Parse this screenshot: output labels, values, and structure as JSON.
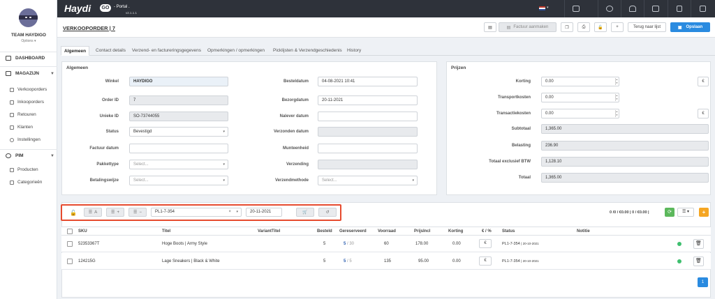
{
  "sidebar": {
    "team": "TEAM HAYDIGO",
    "options": "Options ▾",
    "sections": [
      {
        "label": "DASHBOARD"
      },
      {
        "label": "MAGAZIJN"
      },
      {
        "label": "PIM"
      }
    ],
    "magazijn_items": [
      "Verkooporders",
      "Inkooporders",
      "Retouren",
      "Klanten",
      "Instellingen"
    ],
    "pim_items": [
      "Producten",
      "Categorieën"
    ]
  },
  "topbar": {
    "logo": "Haydi",
    "logo_go": "GO",
    "portal": "- Portal .",
    "version": "v2.1.1.1"
  },
  "header": {
    "title": "VERKOOPORDER | 7",
    "invoice_button": "Factuur aanmaken",
    "back_button": "Terug naar lijst",
    "save_button": "Opslaan"
  },
  "tabs": [
    "Algemeen",
    "Contact details",
    "Verzend- en factureringsgegevens",
    "Opmerkingen / opmerkingen",
    "Picklijsten & Verzendgeschiedenis",
    "History"
  ],
  "general": {
    "heading": "Algemeen",
    "winkel_label": "Winkel",
    "winkel": "HAYDIGO",
    "order_id_label": "Order ID",
    "order_id": "7",
    "unieke_id_label": "Unieke ID",
    "unieke_id": "SO-73744055",
    "status_label": "Status",
    "status": "Bevestigd",
    "factuur_datum_label": "Factuur datum",
    "factuur_datum": "",
    "pakkettype_label": "Pakkettype",
    "pakkettype_placeholder": "Select...",
    "betalingswijze_label": "Betalingswijze",
    "betalingswijze_placeholder": "Select...",
    "besteldatum_label": "Besteldatum",
    "besteldatum": "04-08-2021 10:41",
    "bezorgdatum_label": "Bezorgdatum",
    "bezorgdatum": "20-11-2021",
    "nalever_label": "Nalever datum",
    "nalever": "",
    "verzonden_label": "Verzonden datum",
    "verzonden": "",
    "munteenheid_label": "Munteenheid",
    "munteenheid": "",
    "verzending_label": "Verzending",
    "verzending": "",
    "verzendmethode_label": "Verzendmethode",
    "verzendmethode_placeholder": "Select..."
  },
  "prices": {
    "heading": "Prijzen",
    "korting_label": "Korting",
    "korting": "0.00",
    "korting_unit": "€",
    "transport_label": "Transportkosten",
    "transport": "0.00",
    "transactie_label": "Transactiekosten",
    "transactie": "0.00",
    "transactie_unit": "€",
    "subtotaal_label": "Subtotaal",
    "subtotaal": "1,365.00",
    "belasting_label": "Belasting",
    "belasting": "236.90",
    "excl_label": "Totaal exclusief BTW",
    "excl": "1,128.10",
    "totaal_label": "Totaal",
    "totaal": "1,365.00"
  },
  "toolbar": {
    "btn_a": "A",
    "btn_plus": "+",
    "btn_minus": "−",
    "picklist": "PL1-7-354",
    "date": "20-11-2021",
    "summary": "0 /0 / €0.00 | 0 / €0.00 |",
    "clear": "×",
    "dropdown": "▾"
  },
  "table": {
    "headers": [
      "SKU",
      "Titel",
      "VariantTitel",
      "Besteld",
      "Gereserveerd",
      "Voorraad",
      "PrijsIncl",
      "Korting",
      "€ / %",
      "Status",
      "Notitie"
    ],
    "rows": [
      {
        "sku": "52353367T",
        "titel": "Hoge Boots | Army Style",
        "variant": "",
        "besteld": "5",
        "res": "5",
        "res_of": "/ 30",
        "voorraad": "60",
        "prijs": "178.00",
        "korting": "0.00",
        "unit": "€",
        "status": "PL1-7-354",
        "status_date": "| 20-10-2021"
      },
      {
        "sku": "124215G",
        "titel": "Lage Sneakers | Black & White",
        "variant": "",
        "besteld": "5",
        "res": "5",
        "res_of": "/ 5",
        "voorraad": "135",
        "prijs": "95.00",
        "korting": "0.00",
        "unit": "€",
        "status": "PL1-7-354",
        "status_date": "| 20-10-2021"
      }
    ]
  },
  "pagination": {
    "page": "1"
  },
  "colors": {
    "accent": "#2a8be0",
    "topbar": "#2e323a",
    "highlight": "#e64a2e",
    "green": "#3fbf6f",
    "orange": "#f5a623"
  }
}
